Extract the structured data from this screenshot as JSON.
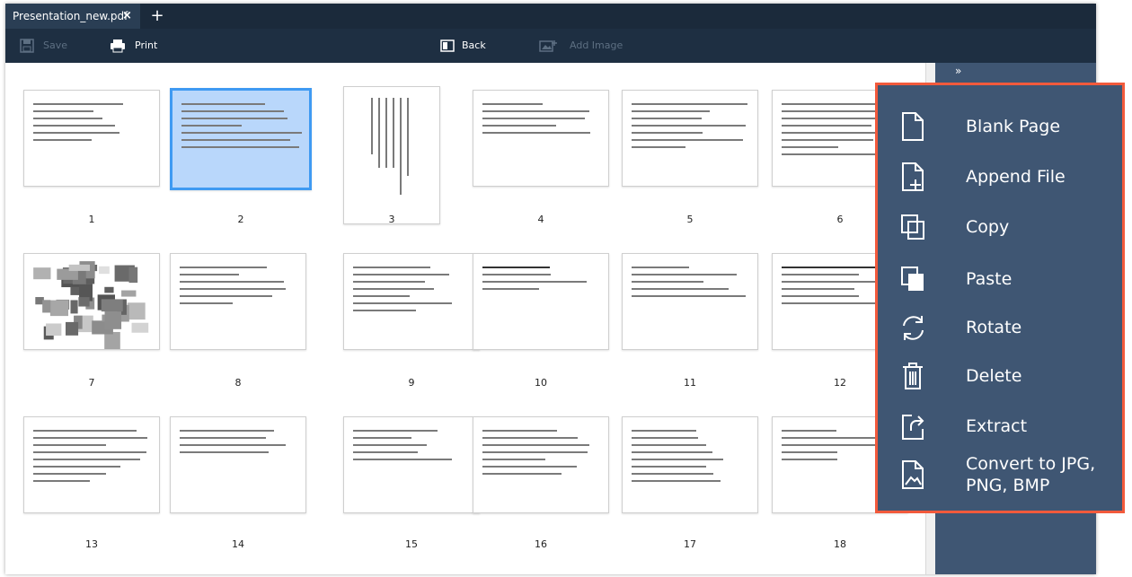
{
  "tab": {
    "title": "Presentation_new.pdf",
    "close": "×",
    "add": "+"
  },
  "toolbar": {
    "save": "Save",
    "print": "Print",
    "back": "Back",
    "add_image": "Add Image"
  },
  "sidepanel": {
    "collapse": "»"
  },
  "pages": [
    "1",
    "2",
    "3",
    "4",
    "5",
    "6",
    "7",
    "8",
    "9",
    "10",
    "11",
    "12",
    "13",
    "14",
    "15",
    "16",
    "17",
    "18"
  ],
  "selected_page": "2",
  "context_menu": {
    "items": [
      {
        "label": "Blank Page",
        "icon": "blank-page-icon"
      },
      {
        "label": "Append File",
        "icon": "append-file-icon"
      },
      {
        "label": "Copy",
        "icon": "copy-icon"
      },
      {
        "label": "Paste",
        "icon": "paste-icon"
      },
      {
        "label": "Rotate",
        "icon": "rotate-icon"
      },
      {
        "label": "Delete",
        "icon": "trash-icon"
      },
      {
        "label": "Extract",
        "icon": "extract-icon"
      },
      {
        "label": "Convert to JPG,\nPNG, BMP",
        "icon": "image-icon"
      }
    ]
  },
  "colors": {
    "menu_bg": "#3f5673",
    "menu_border": "#f25a3c",
    "selection": "#3f9af2",
    "tabbar": "#1b2a3b"
  }
}
